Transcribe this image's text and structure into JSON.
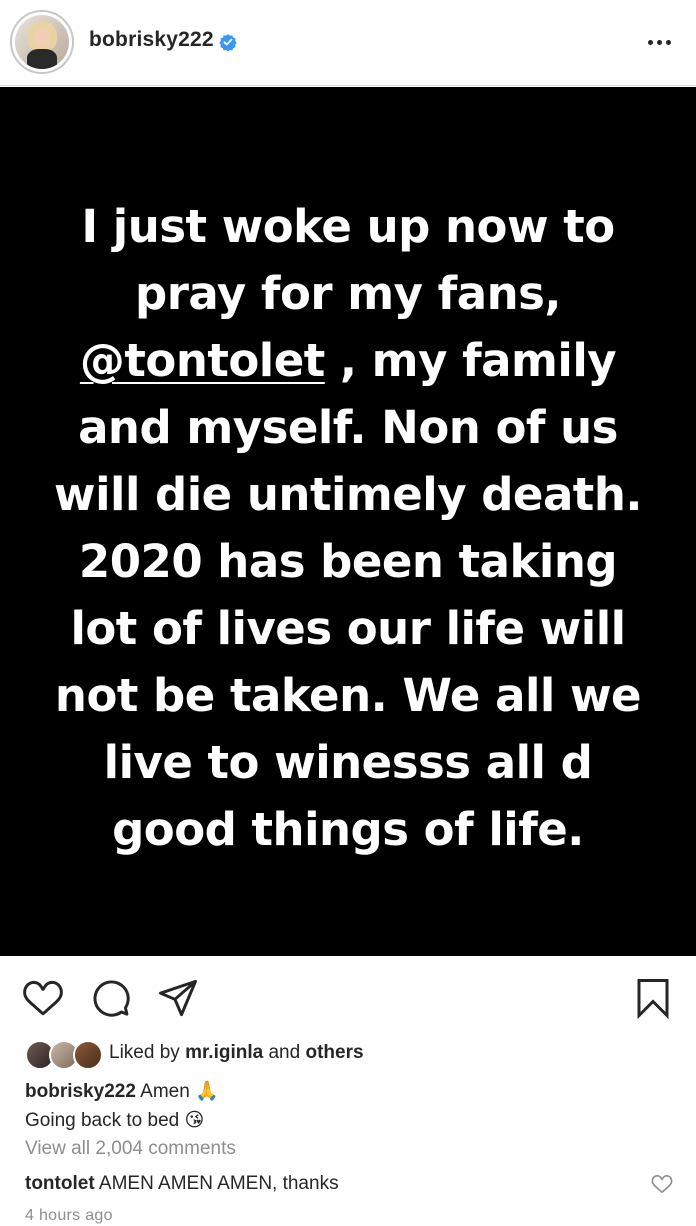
{
  "post": {
    "username": "bobrisky222",
    "story_lines": [
      "I just woke up now to",
      "pray for my fans,",
      "@tontolet",
      ", my family",
      "and myself. Non of us",
      "will die untimely death.",
      "2020 has been taking",
      "lot of lives our life will",
      "not be taken. We all we",
      "live to winesss all d",
      "good things of life."
    ]
  },
  "likes": {
    "prefix": "Liked by",
    "user": "mr.iginla",
    "conjunction": "and",
    "others": "others"
  },
  "caption": {
    "username": "bobrisky222",
    "line1": "Amen",
    "line1_emoji": "🙏",
    "line2": "Going back to bed",
    "line2_emoji": "😘"
  },
  "view_comments": "View all 2,004 comments",
  "comment": {
    "username": "tontolet",
    "text": "AMEN AMEN AMEN, thanks"
  },
  "timestamp": "4 hours ago",
  "icons": {
    "verified": "verified-badge-icon",
    "more": "more-options-icon",
    "like": "heart-icon",
    "comment": "comment-icon",
    "share": "paper-plane-icon",
    "save": "bookmark-icon"
  },
  "colors": {
    "verified": "#3897f0",
    "text": "#262626",
    "muted": "#8e8e8e",
    "image_bg": "#000000"
  }
}
